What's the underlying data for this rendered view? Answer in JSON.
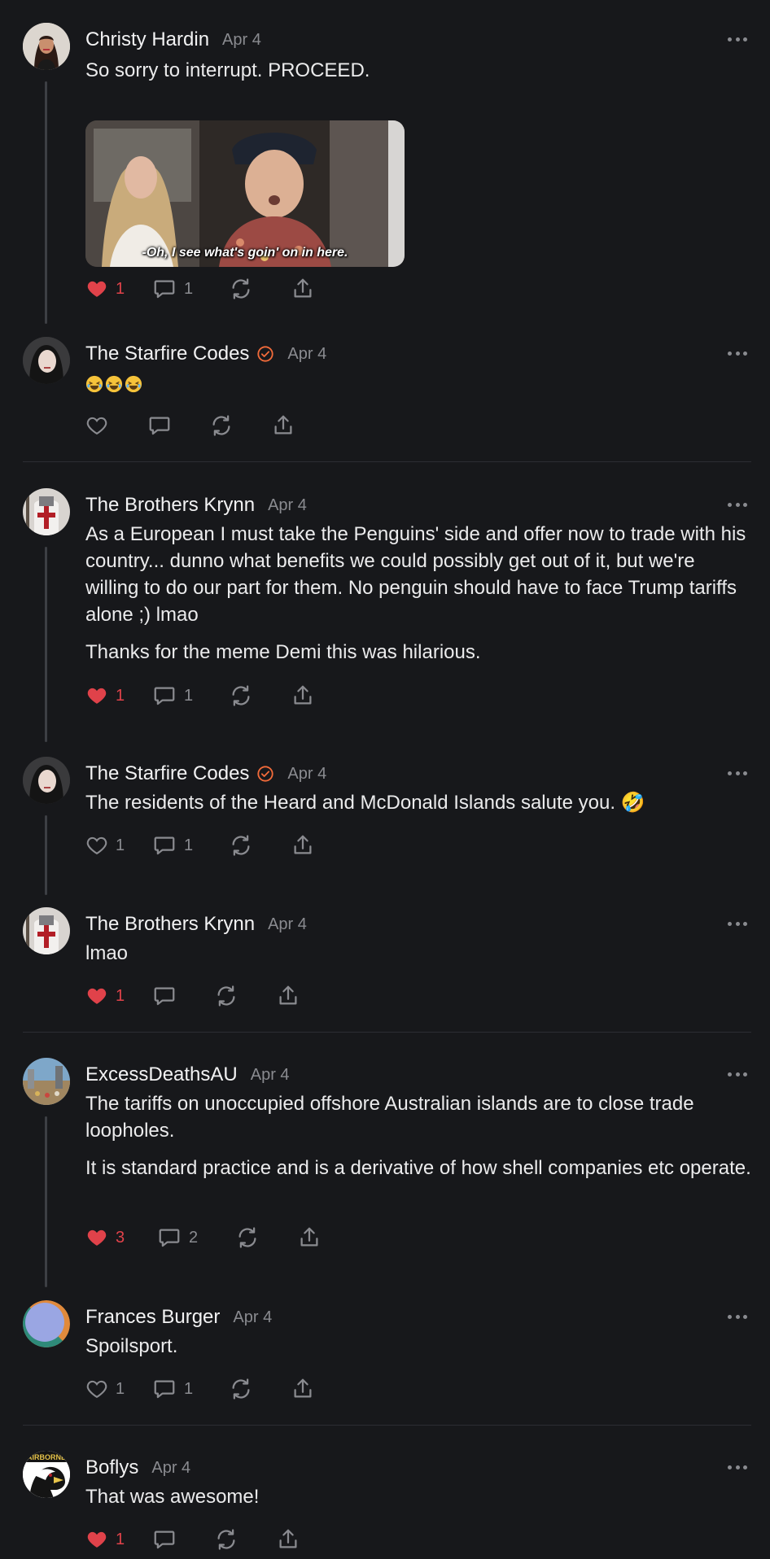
{
  "posts": [
    {
      "author": "Christy Hardin",
      "date": "Apr 4",
      "verified": false,
      "paragraphs": [
        "So sorry to interrupt. PROCEED."
      ],
      "gif_caption": "-Oh, I see what's goin' on in here.",
      "liked": true,
      "likes": "1",
      "comments": "1"
    },
    {
      "author": "The Starfire Codes",
      "date": "Apr 4",
      "verified": true,
      "paragraphs": [
        "🤣🤣🤣"
      ],
      "liked": false,
      "likes": "",
      "comments": ""
    },
    {
      "author": "The Brothers Krynn",
      "date": "Apr 4",
      "verified": false,
      "paragraphs": [
        "As a European I must take the Penguins' side and offer now to trade with his country... dunno what benefits we could possibly get out of it, but we're willing to do our part for them. No penguin should have to face Trump tariffs alone ;) lmao",
        "Thanks for the meme Demi this was hilarious."
      ],
      "liked": true,
      "likes": "1",
      "comments": "1"
    },
    {
      "author": "The Starfire Codes",
      "date": "Apr 4",
      "verified": true,
      "paragraphs": [
        "The residents of the Heard and McDonald Islands salute you. 🤣"
      ],
      "liked": false,
      "likes": "1",
      "comments": "1"
    },
    {
      "author": "The Brothers Krynn",
      "date": "Apr 4",
      "verified": false,
      "paragraphs": [
        "lmao"
      ],
      "liked": true,
      "likes": "1",
      "comments": ""
    },
    {
      "author": "ExcessDeathsAU",
      "date": "Apr 4",
      "verified": false,
      "paragraphs": [
        "The tariffs on unoccupied offshore Australian islands are to close trade loopholes.",
        "It is standard practice and is a derivative of how shell companies etc operate."
      ],
      "liked": true,
      "likes": "3",
      "comments": "2"
    },
    {
      "author": "Frances Burger",
      "date": "Apr 4",
      "verified": false,
      "paragraphs": [
        "Spoilsport."
      ],
      "liked": false,
      "likes": "1",
      "comments": "1"
    },
    {
      "author": "Boflys",
      "date": "Apr 4",
      "verified": false,
      "paragraphs": [
        "That was awesome!"
      ],
      "avatar_text": "AIRBORNE",
      "liked": true,
      "likes": "1",
      "comments": ""
    }
  ],
  "colors": {
    "background": "#17181b",
    "text": "#ebebec",
    "muted": "#8a8b90",
    "like_red": "#e0424a",
    "verified_orange": "#f26b3a"
  },
  "icons": [
    "heart-icon",
    "comment-icon",
    "restack-icon",
    "share-icon",
    "more-options-icon",
    "verified-badge-icon"
  ]
}
